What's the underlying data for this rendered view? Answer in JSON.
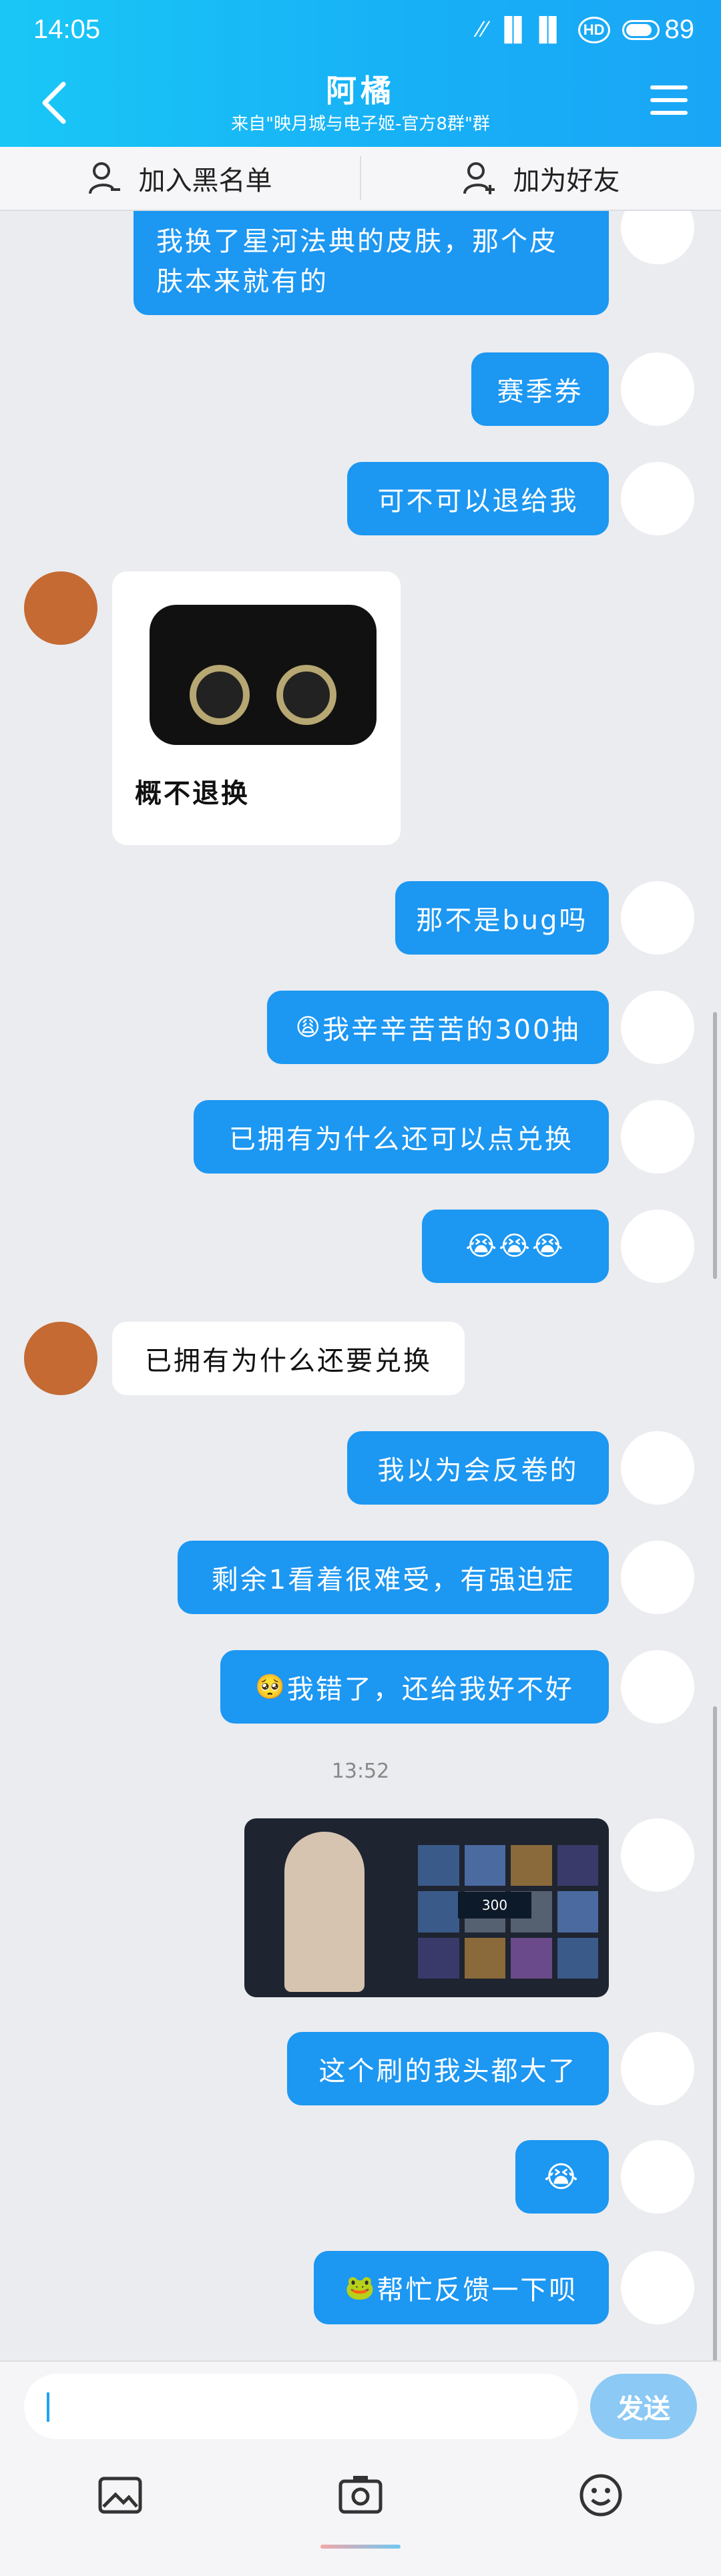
{
  "status": {
    "time": "14:05",
    "signal": "∕∕ ▐▌▐▌",
    "hd": "HD",
    "battery": "89"
  },
  "header": {
    "title": "阿橘",
    "subtitle": "来自\"映月城与电子姬-官方8群\"群"
  },
  "actions": {
    "blacklist": "加入黑名单",
    "add_friend": "加为好友"
  },
  "messages": {
    "m1": "我换了星河法典的皮肤，那个皮肤本来就有的",
    "m2": "赛季券",
    "m3": "可不可以退给我",
    "m4_caption": "概不退换",
    "m5": "那不是bug吗",
    "m6_emoji": "😩",
    "m6": "我辛辛苦苦的300抽",
    "m7": "已拥有为什么还可以点兑换",
    "m8": "😭😭😭",
    "m9": "已拥有为什么还要兑换",
    "m10": "我以为会反卷的",
    "m11": "剩余1看着很难受，有强迫症",
    "m12_emoji": "🥺",
    "m12": "我错了，还给我好不好",
    "timestamp": "13:52",
    "screenshot_value": "300",
    "m13": "这个刷的我头都大了",
    "m14": "😭",
    "m15_emoji": "🐸",
    "m15": "帮忙反馈一下呗"
  },
  "input": {
    "send": "发送"
  },
  "colors": {
    "header_start": "#19c7f6",
    "header_end": "#1aa6f6",
    "bubble_out": "#1c97f2",
    "send_button": "#8cc9f4"
  }
}
